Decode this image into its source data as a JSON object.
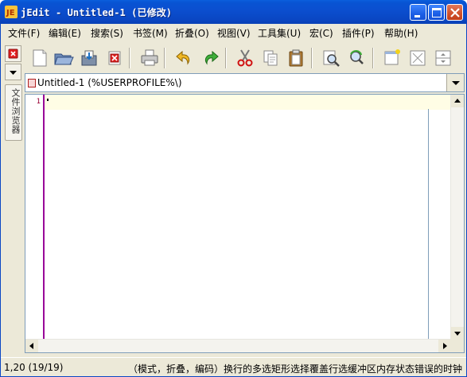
{
  "window": {
    "title": "jEdit - Untitled-1 (已修改)",
    "buttons": {
      "minimize": "minimize-icon",
      "maximize": "maximize-icon",
      "close": "close-icon"
    }
  },
  "menu": {
    "items": [
      "文件(F)",
      "编辑(E)",
      "搜索(S)",
      "书签(M)",
      "折叠(O)",
      "视图(V)",
      "工具集(U)",
      "宏(C)",
      "插件(P)",
      "帮助(H)"
    ]
  },
  "dock": {
    "tab_label": "文件浏览器"
  },
  "toolbar": {
    "icons": [
      "new-file-icon",
      "open-file-icon",
      "save-file-icon",
      "close-file-icon",
      "print-icon",
      "undo-icon",
      "redo-icon",
      "cut-icon",
      "copy-icon",
      "paste-icon",
      "find-icon",
      "find-in-files-icon",
      "new-view-icon",
      "unsplit-icon",
      "split-icon"
    ]
  },
  "buffer": {
    "name": "Untitled-1 (%USERPROFILE%\\)"
  },
  "editor": {
    "line_numbers": [
      "1"
    ],
    "content": ""
  },
  "status": {
    "position": "1,20 (19/19)",
    "message": "（模式，折叠，编码）换行的多选矩形选择覆盖行选缓冲区内存状态错误的时钟"
  },
  "colors": {
    "title_bar": "#0a47c4",
    "chrome": "#ece9d8",
    "gutter_line": "#990099",
    "line_number": "#990033",
    "current_line": "#fffde5"
  }
}
